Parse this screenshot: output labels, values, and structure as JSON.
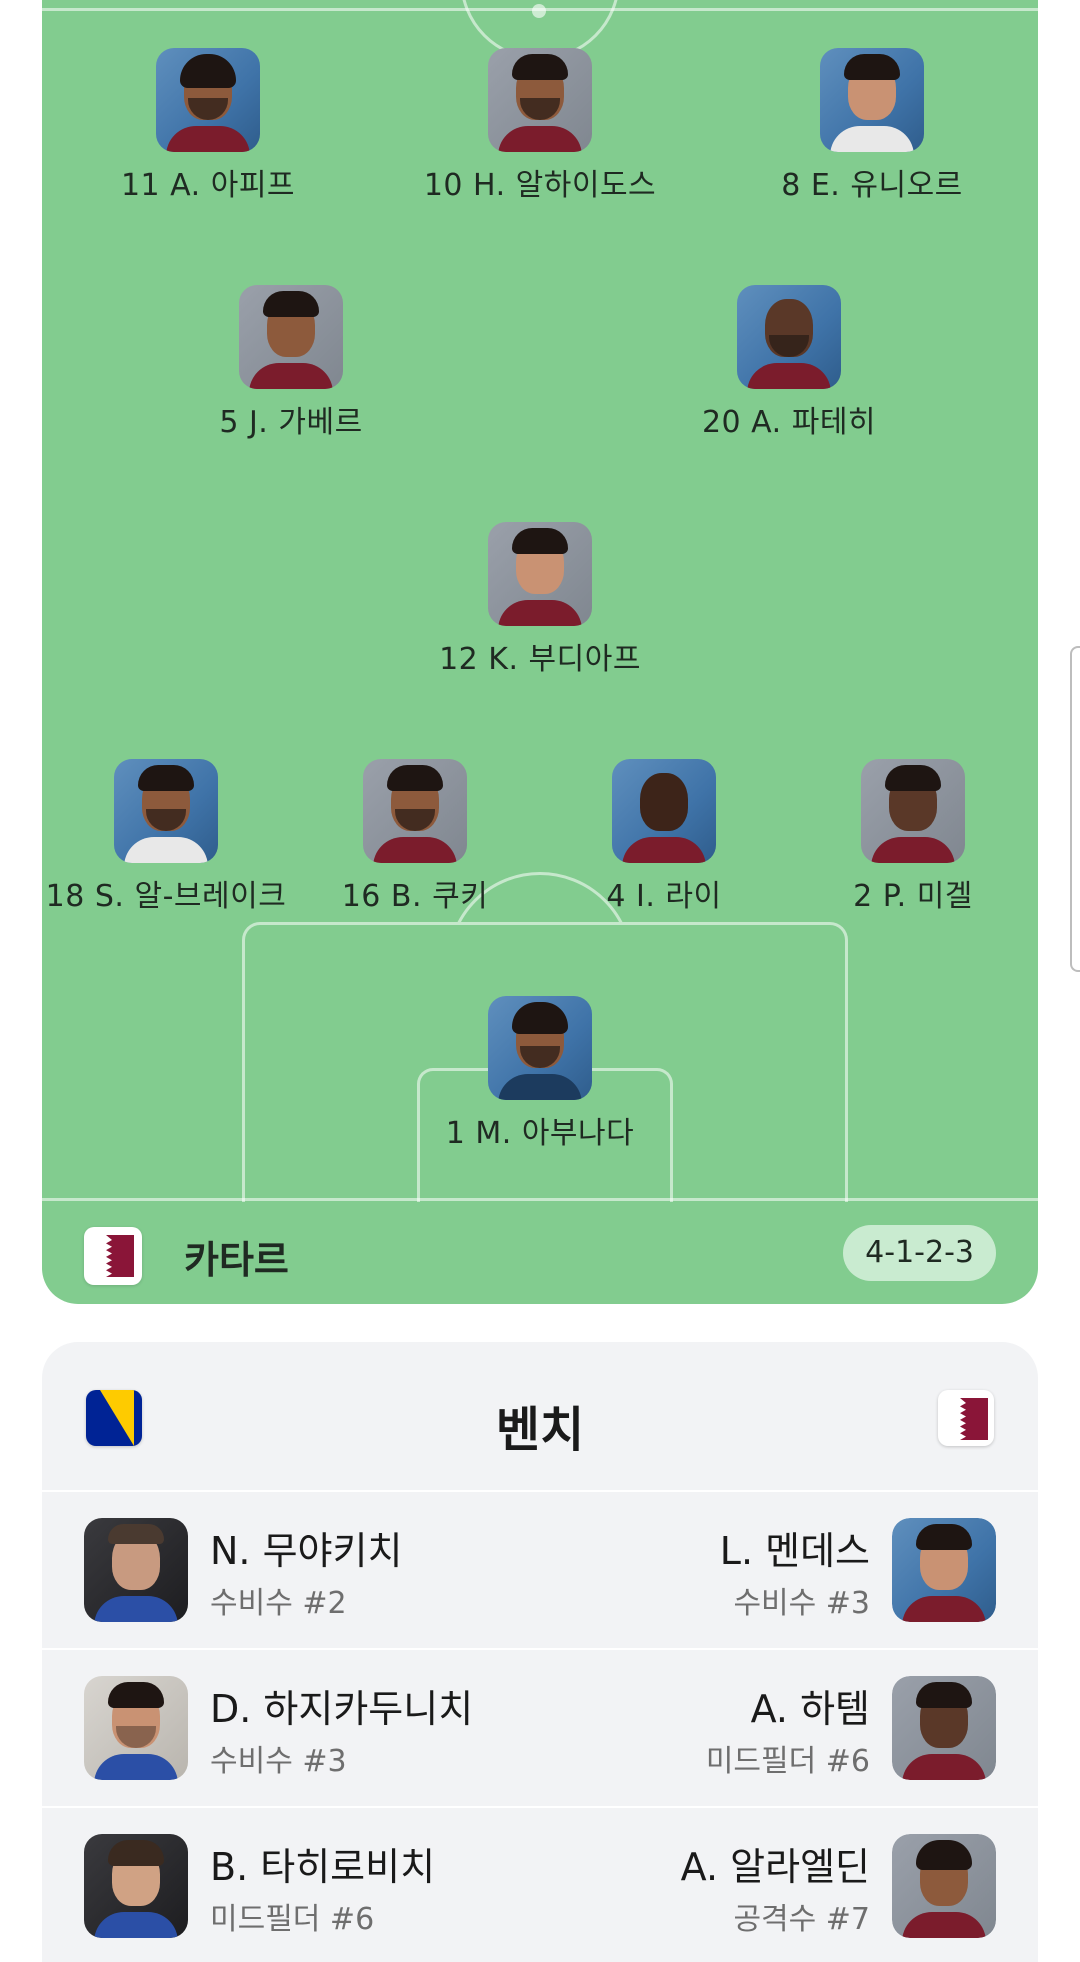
{
  "pitch": {
    "players": [
      {
        "number": "11",
        "name": "11 A. 아피프"
      },
      {
        "number": "10",
        "name": "10 H. 알하이도스"
      },
      {
        "number": "8",
        "name": "8 E. 유니오르"
      },
      {
        "number": "5",
        "name": "5 J. 가베르"
      },
      {
        "number": "20",
        "name": "20 A. 파테히"
      },
      {
        "number": "12",
        "name": "12 K. 부디아프"
      },
      {
        "number": "18",
        "name": "18 S. 알-브레이크"
      },
      {
        "number": "16",
        "name": "16 B. 쿠키"
      },
      {
        "number": "4",
        "name": "4 I. 라이"
      },
      {
        "number": "2",
        "name": "2 P. 미겔"
      },
      {
        "number": "1",
        "name": "1 M. 아부나다"
      }
    ],
    "team": {
      "name": "카타르",
      "formation": "4-1-2-3",
      "flag_colors": {
        "white": "#ffffff",
        "maroon": "#8a1538"
      }
    }
  },
  "bench": {
    "title": "벤치",
    "left_flag": "bosnia-herzegovina-flag",
    "right_flag": "qatar-flag",
    "rows": [
      {
        "left": {
          "name": "N. 무야키치",
          "position": "수비수 #2"
        },
        "right": {
          "name": "L. 멘데스",
          "position": "수비수 #3"
        }
      },
      {
        "left": {
          "name": "D. 하지카두니치",
          "position": "수비수 #3"
        },
        "right": {
          "name": "A. 하템",
          "position": "미드필더 #6"
        }
      },
      {
        "left": {
          "name": "B. 타히로비치",
          "position": "미드필더 #6"
        },
        "right": {
          "name": "A. 알라엘딘",
          "position": "공격수 #7"
        }
      }
    ]
  },
  "colors": {
    "pitch": "#82cc8f",
    "formation_pill": "#c9ebd0",
    "bench_bg": "#f2f3f5"
  }
}
